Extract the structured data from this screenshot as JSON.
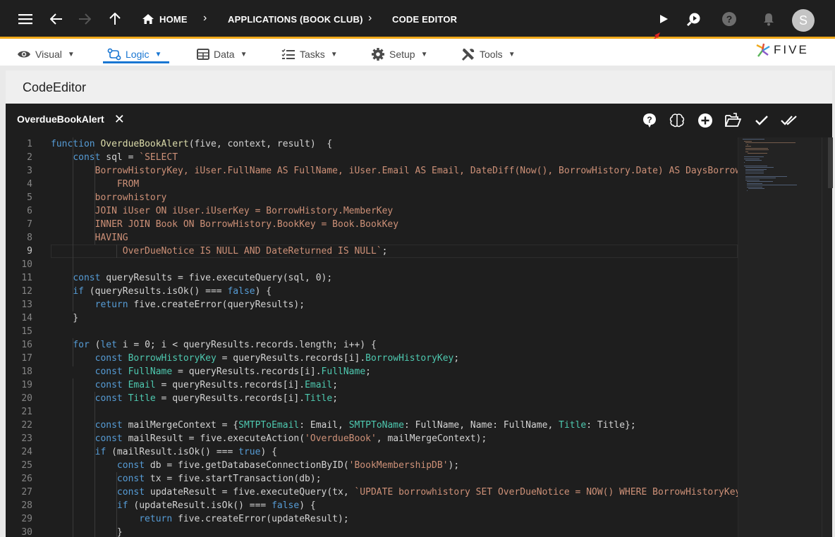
{
  "topbar": {
    "breadcrumb": [
      "HOME",
      "APPLICATIONS (BOOK CLUB)",
      "CODE EDITOR"
    ],
    "avatar_letter": "S",
    "icons": [
      "menu-icon",
      "back-arrow-icon",
      "forward-arrow-icon",
      "up-arrow-icon",
      "home-icon",
      "play-icon",
      "search-icon",
      "help-icon",
      "bell-icon"
    ]
  },
  "menu": {
    "items": [
      {
        "label": "Visual",
        "icon": "eye-icon"
      },
      {
        "label": "Logic",
        "icon": "logic-icon",
        "active": true
      },
      {
        "label": "Data",
        "icon": "table-icon"
      },
      {
        "label": "Tasks",
        "icon": "tasks-icon"
      },
      {
        "label": "Setup",
        "icon": "gear-icon"
      },
      {
        "label": "Tools",
        "icon": "tools-icon"
      }
    ],
    "logo_text": "FIVE"
  },
  "page": {
    "title": "CodeEditor"
  },
  "editor": {
    "tab_label": "OverdueBookAlert",
    "current_line": 9,
    "toolbar": [
      "help-icon",
      "brain-icon",
      "add-icon",
      "open-folder-icon",
      "check-icon",
      "double-check-icon"
    ],
    "lines": [
      "function OverdueBookAlert(five, context, result)  {",
      "    const sql = `SELECT",
      "        BorrowHistoryKey, iUser.FullName AS FullName, iUser.Email AS Email, DateDiff(Now(), BorrowHistory.Date) AS DaysBorrowed",
      "            FROM",
      "        borrowhistory",
      "        JOIN iUser ON iUser.iUserKey = BorrowHistory.MemberKey",
      "        INNER JOIN Book ON BorrowHistory.BookKey = Book.BookKey",
      "        HAVING",
      "             OverDueNotice IS NULL AND DateReturned IS NULL`;",
      "",
      "    const queryResults = five.executeQuery(sql, 0);",
      "    if (queryResults.isOk() === false) {",
      "        return five.createError(queryResults);",
      "    }",
      "",
      "    for (let i = 0; i < queryResults.records.length; i++) {",
      "        const BorrowHistoryKey = queryResults.records[i].BorrowHistoryKey;",
      "        const FullName = queryResults.records[i].FullName;",
      "        const Email = queryResults.records[i].Email;",
      "        const Title = queryResults.records[i].Title;",
      "",
      "        const mailMergeContext = {SMTPToEmail: Email, SMTPToName: FullName, Name: FullName, Title: Title};",
      "        const mailResult = five.executeAction('OverdueBook', mailMergeContext);",
      "        if (mailResult.isOk() === true) {",
      "            const db = five.getDatabaseConnectionByID('BookMembershipDB');",
      "            const tx = five.startTransaction(db);",
      "            const updateResult = five.executeQuery(tx, `UPDATE borrowhistory SET OverDueNotice = NOW() WHERE BorrowHistoryKey = ?`",
      "            if (updateResult.isOk() === false) {",
      "                return five.createError(updateResult);",
      "            }"
    ]
  }
}
